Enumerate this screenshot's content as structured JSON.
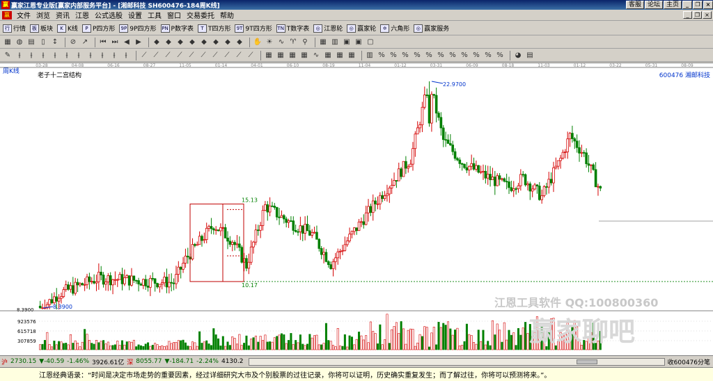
{
  "window": {
    "title": "赢家江恩专业版[赢家内部服务平台] - [湘邮科技  SH600476-184周K线]",
    "buttons": [
      "客服",
      "论坛",
      "主页"
    ]
  },
  "menu": [
    "文件",
    "浏览",
    "资讯",
    "江恩",
    "公式选股",
    "设置",
    "工具",
    "窗口",
    "交易委托",
    "帮助"
  ],
  "toolbar": [
    {
      "icon": "行",
      "label": "行情"
    },
    {
      "icon": "板",
      "label": "板块"
    },
    {
      "icon": "K",
      "label": "K线"
    },
    {
      "icon": "P",
      "label": "P四方形"
    },
    {
      "icon": "9P",
      "label": "9P四方形"
    },
    {
      "icon": "PN",
      "label": "P数字表"
    },
    {
      "icon": "T",
      "label": "T四方形"
    },
    {
      "icon": "9T",
      "label": "9T四方形"
    },
    {
      "icon": "TN",
      "label": "T数字表"
    },
    {
      "icon": "◎",
      "label": "江恩轮"
    },
    {
      "icon": "◎",
      "label": "赢家轮"
    },
    {
      "icon": "✡",
      "label": "六角形"
    },
    {
      "icon": "◎",
      "label": "赢家服务"
    }
  ],
  "chart": {
    "period_label": "周K线",
    "structure_label": "老子十二宫结构",
    "stock_label": "600476  湘邮科技",
    "date_ticks": [
      "03-28",
      "04-08",
      "06-16",
      "08-27",
      "11-05",
      "01-14",
      "04-01",
      "06-10",
      "08-19",
      "11-04",
      "01-12",
      "03-31",
      "06-09",
      "08-18",
      "11-03",
      "01-12",
      "03-22",
      "05-31",
      "08-09"
    ],
    "high_label": "22.9700",
    "low_label": "8.3900",
    "low_axis_label": "8.3900",
    "box_top_label": "15.13",
    "box_bottom_label": "10.17",
    "volume_ticks": [
      "923576",
      "615718",
      "307859"
    ],
    "colors": {
      "up": "#d40000",
      "down": "#008000",
      "box": "#c00000",
      "axis": "#000000"
    }
  },
  "chart_data": {
    "type": "candlestick",
    "title": "老子十二宫结构",
    "price_range": [
      8.39,
      22.97
    ],
    "high": 22.97,
    "low": 8.39,
    "box": {
      "top": 15.13,
      "bottom": 10.17
    },
    "volume_axis_ticks": [
      307859,
      615718,
      923576
    ]
  },
  "watermark": {
    "line1": "江恩工具软件  QQ:100800360",
    "line2": "赢家聊吧"
  },
  "status": {
    "sh_index": "2730.15",
    "sh_change": "▼-40.59",
    "sh_pct": "-1.46%",
    "sh_amount": "3926.61亿",
    "sz_index": "8055.77",
    "sz_change": "▼-184.71",
    "sz_pct": "-2.24%",
    "sz_amount": "4130.2",
    "right_text": "收600476分笔"
  },
  "quote": "江恩经典语录：“时间是决定市场走势的重要因素，经过详细研究大市及个别股票的过往记录，你将可以证明，历史确实重复发生；而了解过往，你将可以预测将来。”。"
}
